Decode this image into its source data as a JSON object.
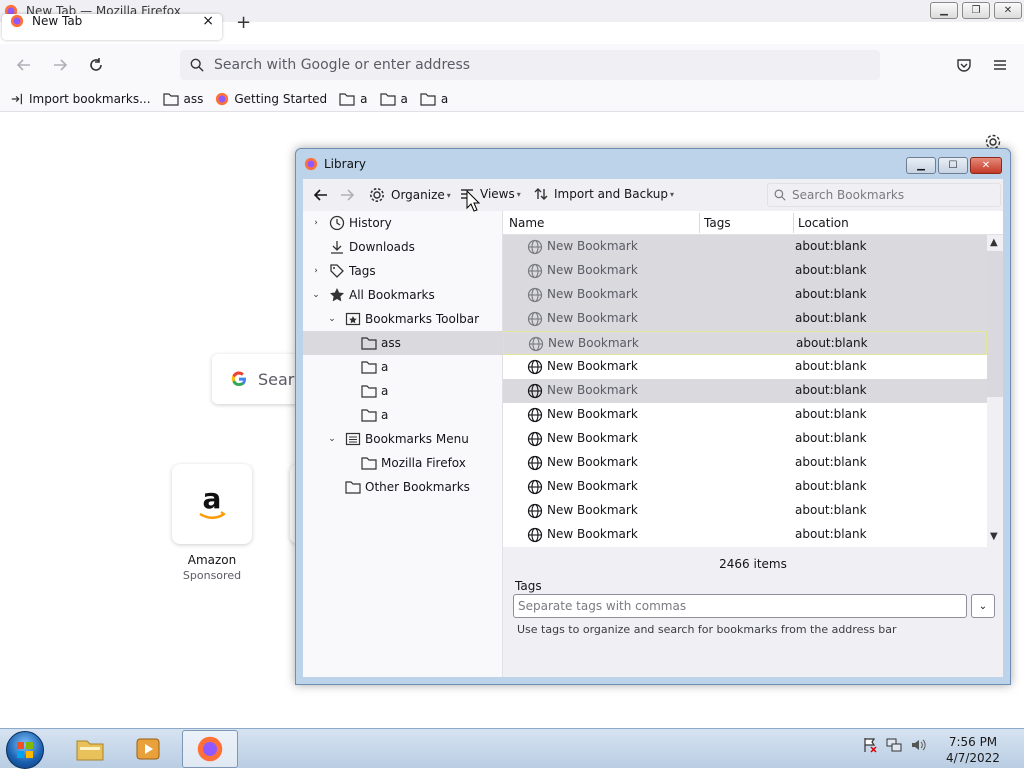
{
  "firefox": {
    "window_title": "New Tab — Mozilla Firefox",
    "tab_label": "New Tab",
    "tab_close": "×",
    "new_tab": "+",
    "url_placeholder": "Search with Google or enter address",
    "bookmarks_toolbar": [
      {
        "label": "Import bookmarks...",
        "icon": "import-icon"
      },
      {
        "label": "ass",
        "icon": "folder-icon"
      },
      {
        "label": "Getting Started",
        "icon": "firefox-icon"
      },
      {
        "label": "a",
        "icon": "folder-icon"
      },
      {
        "label": "a",
        "icon": "folder-icon"
      },
      {
        "label": "a",
        "icon": "folder-icon"
      }
    ],
    "newtab_search_placeholder": "Sear",
    "top_site": {
      "label": "Amazon",
      "sublabel": "Sponsored"
    }
  },
  "library": {
    "title": "Library",
    "toolbar": {
      "organize": "Organize",
      "views": "Views",
      "import_backup": "Import and Backup",
      "search_placeholder": "Search Bookmarks"
    },
    "tree": [
      {
        "label": "History",
        "icon": "clock-icon",
        "twisty": "collapsed",
        "level": 0
      },
      {
        "label": "Downloads",
        "icon": "download-icon",
        "twisty": "none",
        "level": 0
      },
      {
        "label": "Tags",
        "icon": "tag-icon",
        "twisty": "collapsed",
        "level": 0
      },
      {
        "label": "All Bookmarks",
        "icon": "star-icon",
        "twisty": "expanded",
        "level": 0
      },
      {
        "label": "Bookmarks Toolbar",
        "icon": "bookmarks-toolbar-icon",
        "twisty": "expanded",
        "level": 1
      },
      {
        "label": "ass",
        "icon": "folder-icon",
        "twisty": "none",
        "level": 2,
        "selected": true
      },
      {
        "label": "a",
        "icon": "folder-icon",
        "twisty": "none",
        "level": 2
      },
      {
        "label": "a",
        "icon": "folder-icon",
        "twisty": "none",
        "level": 2
      },
      {
        "label": "a",
        "icon": "folder-icon",
        "twisty": "none",
        "level": 2
      },
      {
        "label": "Bookmarks Menu",
        "icon": "bookmarks-menu-icon",
        "twisty": "expanded",
        "level": 1
      },
      {
        "label": "Mozilla Firefox",
        "icon": "folder-icon",
        "twisty": "none",
        "level": 2
      },
      {
        "label": "Other Bookmarks",
        "icon": "folder-icon",
        "twisty": "none",
        "level": 1
      }
    ],
    "columns": {
      "name": "Name",
      "tags": "Tags",
      "location": "Location"
    },
    "rows": [
      {
        "name": "New Bookmark",
        "location": "about:blank",
        "selected": true
      },
      {
        "name": "New Bookmark",
        "location": "about:blank",
        "selected": true
      },
      {
        "name": "New Bookmark",
        "location": "about:blank",
        "selected": true
      },
      {
        "name": "New Bookmark",
        "location": "about:blank",
        "selected": true
      },
      {
        "name": "New Bookmark",
        "location": "about:blank",
        "selected": true,
        "focused": true
      },
      {
        "name": "New Bookmark",
        "location": "about:blank",
        "selected": false
      },
      {
        "name": "New Bookmark",
        "location": "about:blank",
        "selected": false,
        "hover": true
      },
      {
        "name": "New Bookmark",
        "location": "about:blank",
        "selected": false
      },
      {
        "name": "New Bookmark",
        "location": "about:blank",
        "selected": false
      },
      {
        "name": "New Bookmark",
        "location": "about:blank",
        "selected": false
      },
      {
        "name": "New Bookmark",
        "location": "about:blank",
        "selected": false
      },
      {
        "name": "New Bookmark",
        "location": "about:blank",
        "selected": false
      },
      {
        "name": "New Bookmark",
        "location": "about:blank",
        "selected": false
      }
    ],
    "item_count": "2466 items",
    "tags_label": "Tags",
    "tags_placeholder": "Separate tags with commas",
    "tags_help": "Use tags to organize and search for bookmarks from the address bar"
  },
  "taskbar": {
    "time": "7:56 PM",
    "date": "4/7/2022"
  },
  "colors": {
    "library_frame": "#bcd3ea",
    "selection": "#d9d9de",
    "close_button": "#c33a26"
  }
}
